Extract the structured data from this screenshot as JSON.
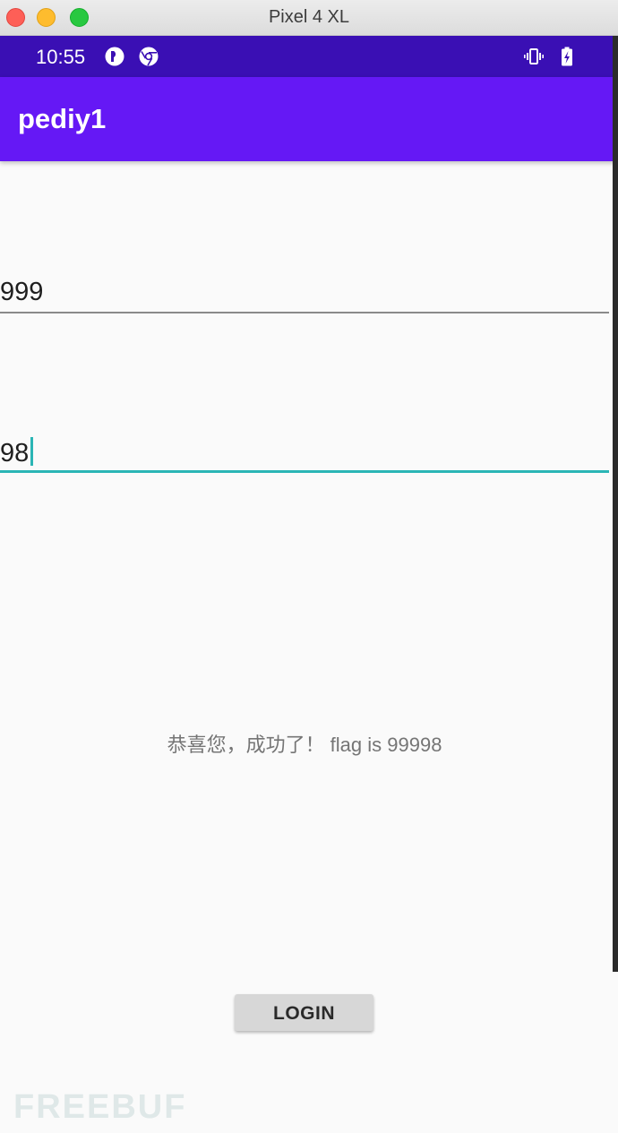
{
  "window": {
    "title": "Pixel 4 XL"
  },
  "status_bar": {
    "time": "10:55",
    "left_icons": [
      "notification-icon",
      "chrome-icon"
    ],
    "right_icons": [
      "vibrate-icon",
      "battery-charging-icon"
    ]
  },
  "app_bar": {
    "title": "pediy1"
  },
  "form": {
    "username_value": "999",
    "password_value": "98",
    "result_message": "恭喜您，成功了！ flag is 99998",
    "login_label": "LOGIN"
  },
  "watermark": {
    "text": "FREEBUF"
  },
  "colors": {
    "status_bar": "#3a0fb4",
    "app_bar": "#6518f5",
    "focused_underline": "#2bb5b5",
    "background": "#fafafa"
  }
}
